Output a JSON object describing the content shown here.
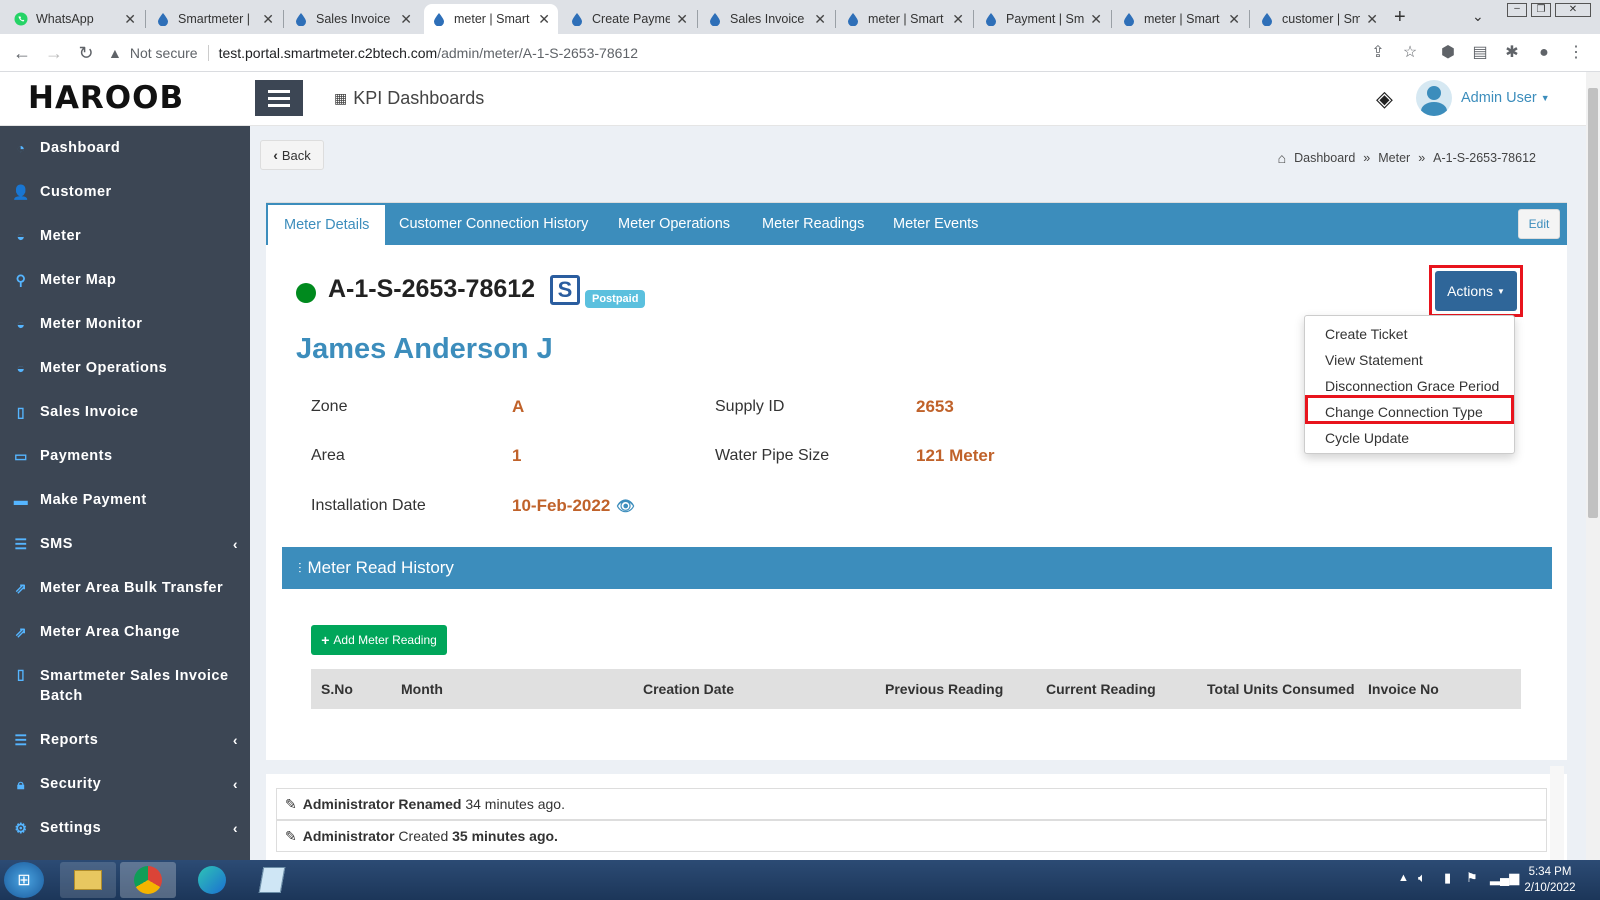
{
  "browser": {
    "tabs": [
      {
        "title": "WhatsApp",
        "icon": "whatsapp-icon"
      },
      {
        "title": "Smartmeter |",
        "icon": "drop-icon"
      },
      {
        "title": "Sales Invoice",
        "icon": "drop-icon"
      },
      {
        "title": "meter | Smart",
        "icon": "drop-icon"
      },
      {
        "title": "Create Payme",
        "icon": "drop-icon"
      },
      {
        "title": "Sales Invoice",
        "icon": "drop-icon"
      },
      {
        "title": "meter | Smart",
        "icon": "drop-icon"
      },
      {
        "title": "Payment | Sm",
        "icon": "drop-icon"
      },
      {
        "title": "meter | Smart",
        "icon": "drop-icon"
      },
      {
        "title": "customer | Sm",
        "icon": "drop-icon"
      }
    ],
    "security_label": "Not secure",
    "url_host": "test.portal.smartmeter.c2btech.com",
    "url_path": "/admin/meter/A-1-S-2653-78612"
  },
  "header": {
    "logo": "HAROOB",
    "section_title": "KPI Dashboards",
    "user_name": "Admin User"
  },
  "sidebar": {
    "items": [
      {
        "label": "Dashboard",
        "icon": "pie-chart-icon"
      },
      {
        "label": "Customer",
        "icon": "user-icon"
      },
      {
        "label": "Meter",
        "icon": "gauge-icon"
      },
      {
        "label": "Meter Map",
        "icon": "map-pin-icon"
      },
      {
        "label": "Meter Monitor",
        "icon": "gauge-icon"
      },
      {
        "label": "Meter Operations",
        "icon": "gauge-icon"
      },
      {
        "label": "Sales Invoice",
        "icon": "file-icon"
      },
      {
        "label": "Payments",
        "icon": "money-icon"
      },
      {
        "label": "Make Payment",
        "icon": "card-icon"
      },
      {
        "label": "SMS",
        "icon": "list-icon"
      },
      {
        "label": "Meter Area Bulk Transfer",
        "icon": "transfer-icon"
      },
      {
        "label": "Meter Area Change",
        "icon": "transfer-icon"
      },
      {
        "label": "Smartmeter Sales Invoice",
        "label2": "Batch",
        "icon": "file-icon"
      },
      {
        "label": "Reports",
        "icon": "list-icon"
      },
      {
        "label": "Security",
        "icon": "lock-icon"
      },
      {
        "label": "Settings",
        "icon": "gear-icon"
      }
    ]
  },
  "page": {
    "back_label": "Back",
    "breadcrumb": [
      "Dashboard",
      "Meter",
      "A-1-S-2653-78612"
    ],
    "tabs": [
      "Meter Details",
      "Customer Connection History",
      "Meter Operations",
      "Meter Readings",
      "Meter Events"
    ],
    "edit_label": "Edit",
    "meter_id": "A-1-S-2653-78612",
    "meter_type_badge": "Postpaid",
    "customer_name": "James Anderson J",
    "actions_label": "Actions",
    "actions_menu": [
      "Create Ticket",
      "View Statement",
      "Disconnection Grace Period",
      "Change Connection Type",
      "Cycle Update"
    ],
    "details": {
      "zone_label": "Zone",
      "zone_value": "A",
      "area_label": "Area",
      "area_value": "1",
      "install_label": "Installation Date",
      "install_value": "10-Feb-2022",
      "supply_label": "Supply ID",
      "supply_value": "2653",
      "pipe_label": "Water Pipe Size",
      "pipe_value": "121 Meter"
    },
    "read_history_title": "Meter Read History",
    "add_reading_label": "Add Meter Reading",
    "table_headers": [
      "S.No",
      "Month",
      "Creation Date",
      "Previous Reading",
      "Current Reading",
      "Total Units Consumed",
      "Invoice No"
    ],
    "activity": [
      {
        "actor": "Administrator",
        "action": "Renamed",
        "time": "34 minutes ago."
      },
      {
        "actor": "Administrator",
        "action": "Created",
        "time": "35 minutes ago."
      }
    ]
  },
  "taskbar": {
    "time": "5:34 PM",
    "date": "2/10/2022"
  },
  "colors": {
    "sidebar_bg": "#3c4654",
    "primary": "#3c8dbc",
    "value_orange": "#c0622a",
    "success_green": "#00a65a",
    "highlight_red": "#e8141d"
  }
}
